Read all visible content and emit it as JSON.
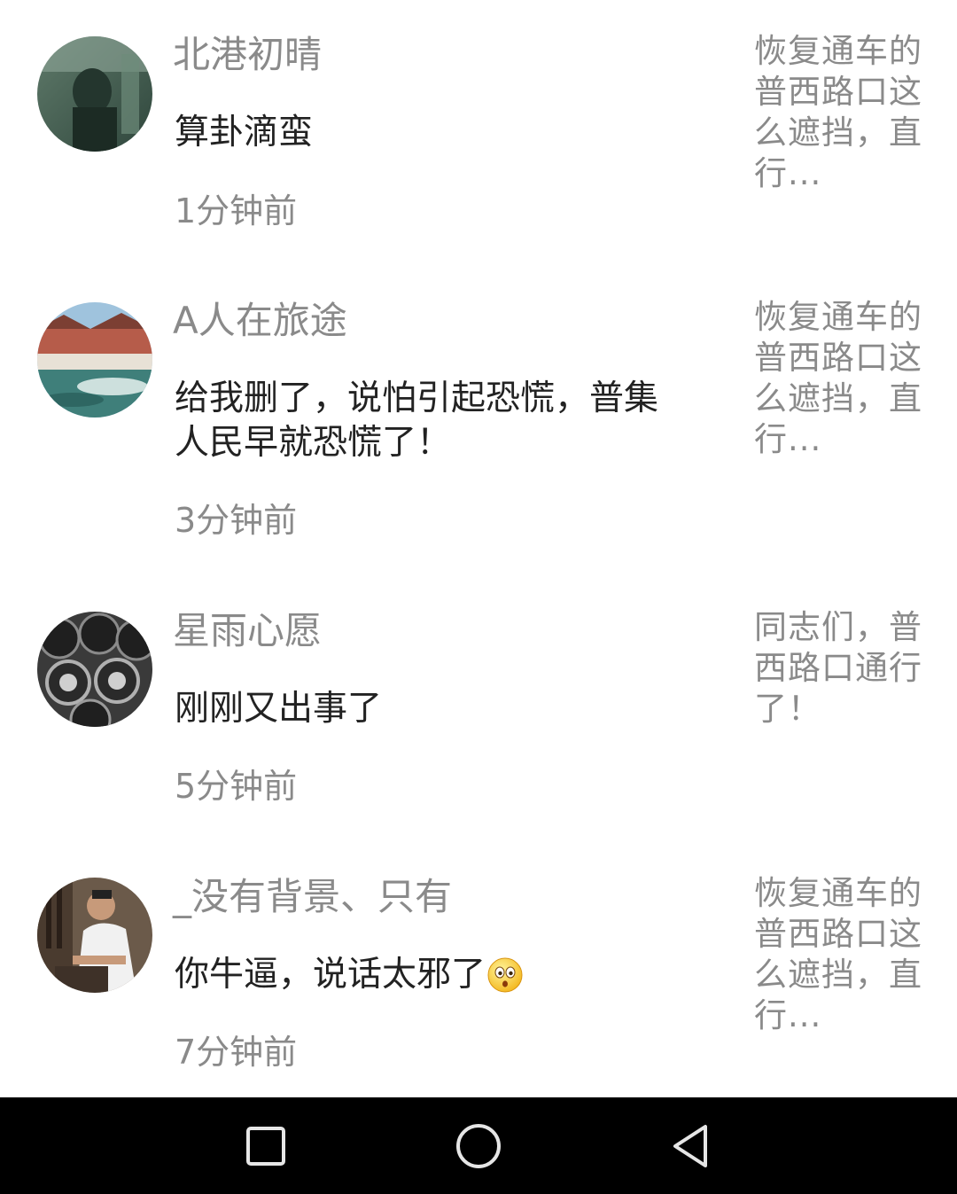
{
  "comments": [
    {
      "username": "北港初晴",
      "text": "算卦滴蛮",
      "time": "1分钟前",
      "ref": "恢复通车的普西路口这么遮挡，直行..."
    },
    {
      "username": "A人在旅途",
      "text": "给我删了，说怕引起恐慌，普集人民早就恐慌了！",
      "time": "3分钟前",
      "ref": "恢复通车的普西路口这么遮挡，直行..."
    },
    {
      "username": "星雨心愿",
      "text": "刚刚又出事了",
      "time": "5分钟前",
      "ref": "同志们，普西路口通行了！"
    },
    {
      "username": "_没有背景、只有",
      "text": "你牛逼，说话太邪了",
      "time": "7分钟前",
      "ref": "恢复通车的普西路口这么遮挡，直行...",
      "emoji": "surprised-face-emoji"
    }
  ],
  "navbar": {
    "recent_icon": "square-recents-icon",
    "home_icon": "circle-home-icon",
    "back_icon": "triangle-back-icon"
  }
}
